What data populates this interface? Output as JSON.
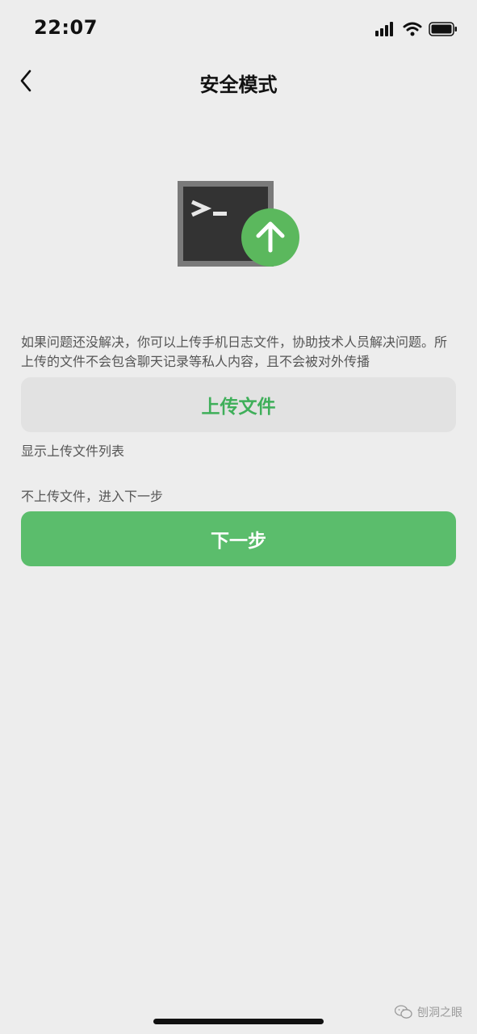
{
  "status_bar": {
    "time": "22:07",
    "icons": [
      "cellular-signal-icon",
      "wifi-icon",
      "battery-icon"
    ]
  },
  "nav": {
    "back_icon": "chevron-left-icon",
    "title": "安全模式"
  },
  "hero": {
    "icon": "terminal-upload-icon",
    "terminal_prompt": ">_",
    "badge_icon": "arrow-up-icon",
    "badge_color": "#5bb85d"
  },
  "main": {
    "description": "如果问题还没解决，你可以上传手机日志文件，协助技术人员解决问题。所上传的文件不会包含聊天记录等私人内容，且不会被对外传播",
    "upload_button_label": "上传文件",
    "show_list_label": "显示上传文件列表",
    "skip_hint": "不上传文件，进入下一步",
    "next_button_label": "下一步"
  },
  "watermark": {
    "icon": "wechat-icon",
    "text": "刨洞之眼"
  },
  "colors": {
    "background": "#ededed",
    "accent_green": "#5bbd6c",
    "upload_text_green": "#3faf5a",
    "secondary_button_bg": "#e2e2e2"
  }
}
